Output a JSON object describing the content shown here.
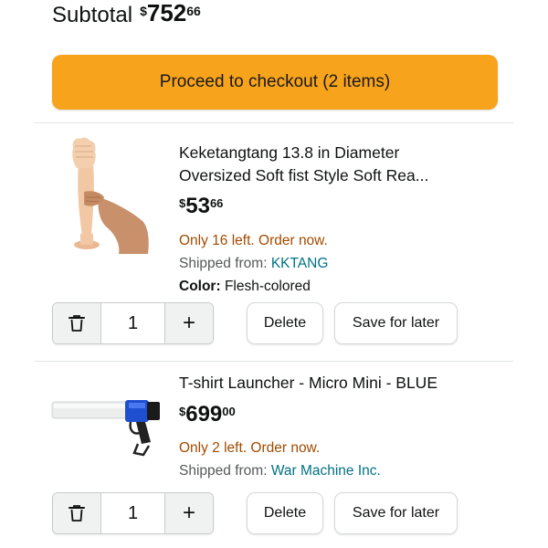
{
  "subtotal": {
    "label": "Subtotal",
    "currency": "$",
    "whole": "752",
    "fraction": "66"
  },
  "checkout": {
    "label": "Proceed to checkout (2 items)",
    "color": "#f7a31c"
  },
  "items": [
    {
      "title_line1": "Keketangtang 13.8 in Diameter",
      "title_line2": "Oversized Soft fist Style Soft Rea...",
      "price": {
        "currency": "$",
        "whole": "53",
        "fraction": "66"
      },
      "stock": "Only 16 left. Order now.",
      "shipped_label": "Shipped from:",
      "seller": "KKTANG",
      "color_label": "Color:",
      "color_value": "Flesh-colored",
      "quantity": "1",
      "delete_label": "Delete",
      "save_label": "Save for later",
      "image_icon": "flesh-colored-fist-toy-image"
    },
    {
      "title_line1": "T-shirt Launcher - Micro Mini - BLUE",
      "price": {
        "currency": "$",
        "whole": "699",
        "fraction": "00"
      },
      "stock": "Only 2 left. Order now.",
      "shipped_label": "Shipped from:",
      "seller": "War Machine Inc.",
      "quantity": "1",
      "delete_label": "Delete",
      "save_label": "Save for later",
      "image_icon": "t-shirt-launcher-image"
    }
  ],
  "colors": {
    "stock_text": "#a14b00",
    "seller_link": "#007185",
    "muted_text": "#565959"
  }
}
